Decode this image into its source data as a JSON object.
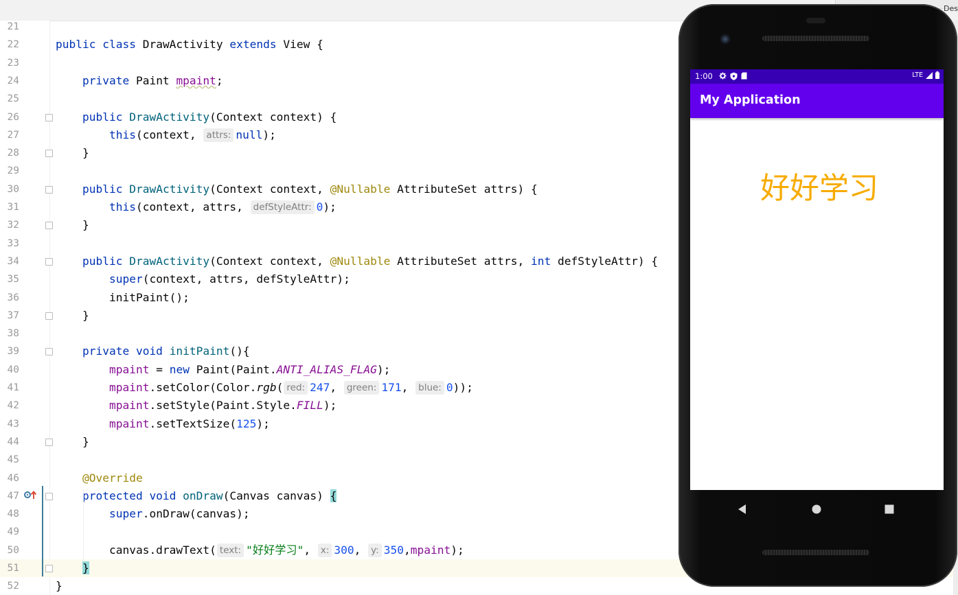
{
  "topbar": {
    "corner_label": "Des"
  },
  "editor": {
    "lines": [
      {
        "n": "21",
        "cls": "",
        "segs": []
      },
      {
        "n": "22",
        "cls": "",
        "segs": [
          [
            "kw",
            "public class "
          ],
          [
            "",
            "DrawActivity "
          ],
          [
            "kw",
            "extends "
          ],
          [
            "",
            "View {"
          ]
        ]
      },
      {
        "n": "23",
        "cls": "",
        "segs": []
      },
      {
        "n": "24",
        "cls": "",
        "segs": [
          [
            "",
            "    "
          ],
          [
            "kw",
            "private "
          ],
          [
            "",
            "Paint "
          ],
          [
            "fld squiggle",
            "mpaint"
          ],
          [
            "",
            ";"
          ]
        ]
      },
      {
        "n": "25",
        "cls": "",
        "segs": []
      },
      {
        "n": "26",
        "cls": "",
        "segs": [
          [
            "",
            "    "
          ],
          [
            "kw",
            "public "
          ],
          [
            "fn",
            "DrawActivity"
          ],
          [
            "",
            "(Context context) {"
          ]
        ]
      },
      {
        "n": "27",
        "cls": "",
        "segs": [
          [
            "",
            "        "
          ],
          [
            "kw",
            "this"
          ],
          [
            "",
            "(context, "
          ],
          [
            "hint",
            "attrs:"
          ],
          [
            "kw",
            "null"
          ],
          [
            "",
            ");"
          ]
        ]
      },
      {
        "n": "28",
        "cls": "",
        "segs": [
          [
            "",
            "    }"
          ]
        ]
      },
      {
        "n": "29",
        "cls": "",
        "segs": []
      },
      {
        "n": "30",
        "cls": "",
        "segs": [
          [
            "",
            "    "
          ],
          [
            "kw",
            "public "
          ],
          [
            "fn",
            "DrawActivity"
          ],
          [
            "",
            "(Context context, "
          ],
          [
            "ann",
            "@Nullable "
          ],
          [
            "",
            "AttributeSet attrs) {"
          ]
        ]
      },
      {
        "n": "31",
        "cls": "",
        "segs": [
          [
            "",
            "        "
          ],
          [
            "kw",
            "this"
          ],
          [
            "",
            "(context, attrs, "
          ],
          [
            "hint",
            "defStyleAttr:"
          ],
          [
            "num",
            "0"
          ],
          [
            "",
            ");"
          ]
        ]
      },
      {
        "n": "32",
        "cls": "",
        "segs": [
          [
            "",
            "    }"
          ]
        ]
      },
      {
        "n": "33",
        "cls": "",
        "segs": []
      },
      {
        "n": "34",
        "cls": "",
        "segs": [
          [
            "",
            "    "
          ],
          [
            "kw",
            "public "
          ],
          [
            "fn",
            "DrawActivity"
          ],
          [
            "",
            "(Context context, "
          ],
          [
            "ann",
            "@Nullable "
          ],
          [
            "",
            "AttributeSet attrs, "
          ],
          [
            "kw",
            "int "
          ],
          [
            "",
            "defStyleAttr) {"
          ]
        ]
      },
      {
        "n": "35",
        "cls": "",
        "segs": [
          [
            "",
            "        "
          ],
          [
            "kw",
            "super"
          ],
          [
            "",
            "(context, attrs, defStyleAttr);"
          ]
        ]
      },
      {
        "n": "36",
        "cls": "",
        "segs": [
          [
            "",
            "        initPaint();"
          ]
        ]
      },
      {
        "n": "37",
        "cls": "",
        "segs": [
          [
            "",
            "    }"
          ]
        ]
      },
      {
        "n": "38",
        "cls": "",
        "segs": []
      },
      {
        "n": "39",
        "cls": "",
        "segs": [
          [
            "",
            "    "
          ],
          [
            "kw",
            "private void "
          ],
          [
            "fn",
            "initPaint"
          ],
          [
            "",
            "(){"
          ]
        ]
      },
      {
        "n": "40",
        "cls": "",
        "segs": [
          [
            "",
            "        "
          ],
          [
            "fld",
            "mpaint "
          ],
          [
            "",
            "= "
          ],
          [
            "kw",
            "new "
          ],
          [
            "",
            "Paint(Paint."
          ],
          [
            "st",
            "ANTI_ALIAS_FLAG"
          ],
          [
            "",
            ");"
          ]
        ]
      },
      {
        "n": "41",
        "cls": "",
        "segs": [
          [
            "",
            "        "
          ],
          [
            "fld",
            "mpaint"
          ],
          [
            "",
            ".setColor(Color."
          ],
          [
            "it",
            "rgb"
          ],
          [
            "",
            "("
          ],
          [
            "hint",
            "red:"
          ],
          [
            "num",
            "247"
          ],
          [
            "",
            ", "
          ],
          [
            "hint",
            "green:"
          ],
          [
            "num",
            "171"
          ],
          [
            "",
            ", "
          ],
          [
            "hint",
            "blue:"
          ],
          [
            "num",
            "0"
          ],
          [
            "",
            "));"
          ]
        ]
      },
      {
        "n": "42",
        "cls": "",
        "segs": [
          [
            "",
            "        "
          ],
          [
            "fld",
            "mpaint"
          ],
          [
            "",
            ".setStyle(Paint.Style."
          ],
          [
            "st",
            "FILL"
          ],
          [
            "",
            ");"
          ]
        ]
      },
      {
        "n": "43",
        "cls": "",
        "segs": [
          [
            "",
            "        "
          ],
          [
            "fld",
            "mpaint"
          ],
          [
            "",
            ".setTextSize("
          ],
          [
            "num",
            "125"
          ],
          [
            "",
            ");"
          ]
        ]
      },
      {
        "n": "44",
        "cls": "",
        "segs": [
          [
            "",
            "    }"
          ]
        ]
      },
      {
        "n": "45",
        "cls": "",
        "segs": []
      },
      {
        "n": "46",
        "cls": "",
        "segs": [
          [
            "",
            "    "
          ],
          [
            "ann",
            "@Override"
          ]
        ]
      },
      {
        "n": "47",
        "cls": "",
        "segs": [
          [
            "",
            "    "
          ],
          [
            "kw",
            "protected void "
          ],
          [
            "fn",
            "onDraw"
          ],
          [
            "",
            "(Canvas canvas) "
          ],
          [
            "brace-hl",
            "{"
          ]
        ]
      },
      {
        "n": "48",
        "cls": "",
        "segs": [
          [
            "",
            "        "
          ],
          [
            "kw",
            "super"
          ],
          [
            "",
            ".onDraw(canvas);"
          ]
        ]
      },
      {
        "n": "49",
        "cls": "",
        "segs": []
      },
      {
        "n": "50",
        "cls": "",
        "segs": [
          [
            "",
            "        canvas.drawText("
          ],
          [
            "hint",
            "text:"
          ],
          [
            "str",
            "\"好好学习\""
          ],
          [
            "",
            ", "
          ],
          [
            "hint",
            "x:"
          ],
          [
            "num",
            "300"
          ],
          [
            "",
            ", "
          ],
          [
            "hint",
            "y:"
          ],
          [
            "num",
            "350"
          ],
          [
            "",
            ","
          ],
          [
            "fld",
            "mpaint"
          ],
          [
            "",
            ");"
          ]
        ]
      },
      {
        "n": "51",
        "cls": "current",
        "segs": [
          [
            "",
            "    "
          ],
          [
            "brace-hl",
            "}"
          ]
        ]
      },
      {
        "n": "52",
        "cls": "",
        "segs": [
          [
            "",
            "}"
          ]
        ]
      }
    ],
    "fold_markers": [
      "26",
      "28",
      "30",
      "32",
      "34",
      "37",
      "39",
      "44",
      "47",
      "51"
    ]
  },
  "phone": {
    "status_time": "1:00",
    "status_network": "LTE",
    "app_title": "My Application",
    "canvas_text": "好好学习",
    "canvas_text_color": "#f7ab00",
    "statusbar_color": "#3700b3",
    "appbar_color": "#6200ee",
    "status_icons": [
      "settings-icon",
      "shield-icon",
      "sd-card-icon"
    ],
    "nav_buttons": [
      "back-icon",
      "home-icon",
      "recents-icon"
    ]
  }
}
